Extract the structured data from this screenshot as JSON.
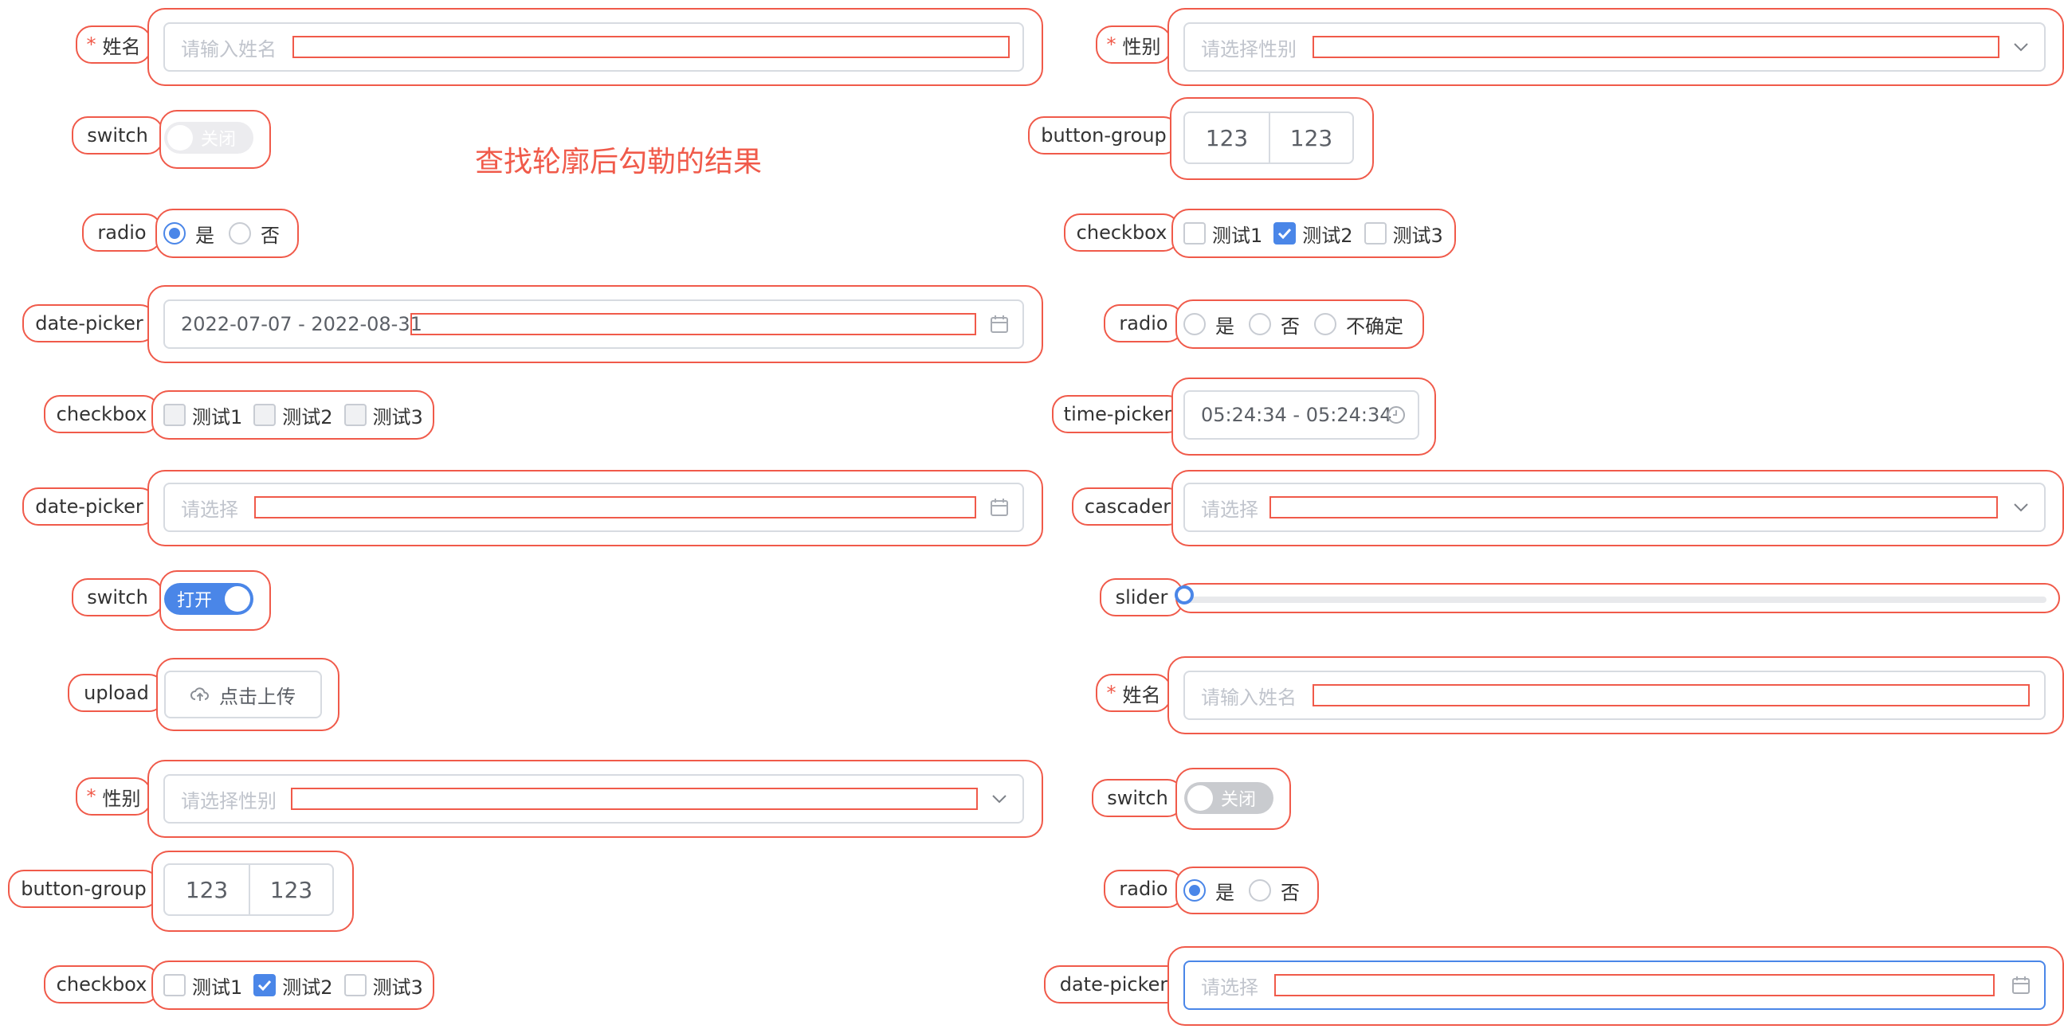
{
  "notice": "查找轮廓后勾勒的结果",
  "left": {
    "name": {
      "label": "姓名",
      "placeholder": "请输入姓名"
    },
    "switch1": {
      "label": "switch",
      "text": "关闭"
    },
    "radio1": {
      "label": "radio",
      "options": [
        "是",
        "否"
      ]
    },
    "date1": {
      "label": "date-picker",
      "value": "2022-07-07 - 2022-08-31"
    },
    "checkbox1": {
      "label": "checkbox",
      "options": [
        "测试1",
        "测试2",
        "测试3"
      ]
    },
    "date2": {
      "label": "date-picker",
      "placeholder": "请选择"
    },
    "switch2": {
      "label": "switch",
      "text": "打开"
    },
    "upload": {
      "label": "upload",
      "button": "点击上传"
    },
    "gender": {
      "label": "性别",
      "placeholder": "请选择性别"
    },
    "bgroup": {
      "label": "button-group",
      "buttons": [
        "123",
        "123"
      ]
    },
    "checkbox2": {
      "label": "checkbox",
      "options": [
        "测试1",
        "测试2",
        "测试3"
      ]
    }
  },
  "right": {
    "gender": {
      "label": "性别",
      "placeholder": "请选择性别"
    },
    "bgroup": {
      "label": "button-group",
      "buttons": [
        "123",
        "123"
      ]
    },
    "checkbox": {
      "label": "checkbox",
      "options": [
        "测试1",
        "测试2",
        "测试3"
      ]
    },
    "radio1": {
      "label": "radio",
      "options": [
        "是",
        "否",
        "不确定"
      ]
    },
    "time": {
      "label": "time-picker",
      "value": "05:24:34 - 05:24:34"
    },
    "cascader": {
      "label": "cascader",
      "placeholder": "请选择"
    },
    "slider": {
      "label": "slider",
      "value": 0
    },
    "name": {
      "label": "姓名",
      "placeholder": "请输入姓名"
    },
    "switch": {
      "label": "switch",
      "text": "关闭"
    },
    "radio2": {
      "label": "radio",
      "options": [
        "是",
        "否"
      ]
    },
    "date": {
      "label": "date-picker",
      "placeholder": "请选择"
    }
  },
  "colors": {
    "outline": "#f05a4a",
    "primary": "#4a86e8"
  }
}
